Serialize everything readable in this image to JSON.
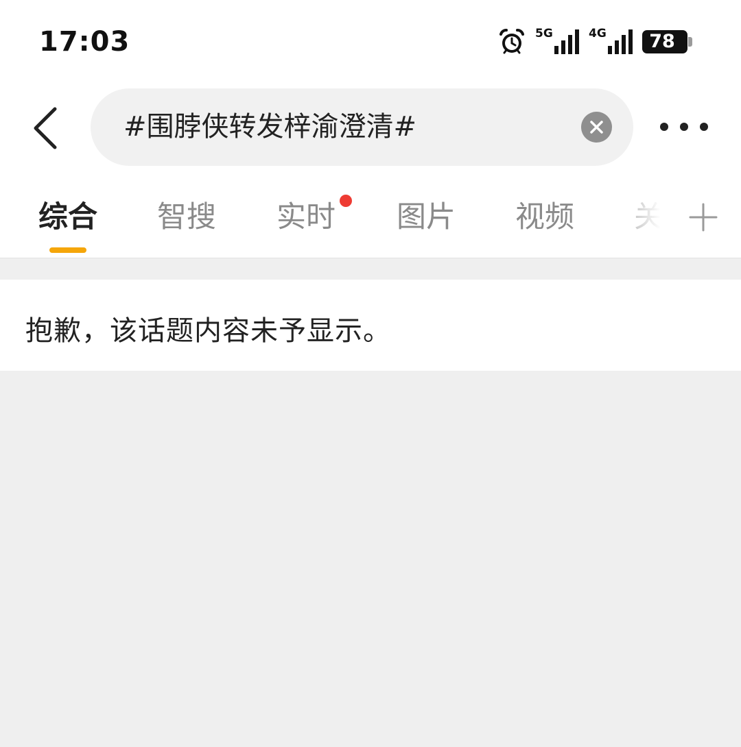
{
  "status_bar": {
    "time": "17:03",
    "alarm_icon": "alarm-clock-icon",
    "signal_1": {
      "network": "5G"
    },
    "signal_2": {
      "network": "4G"
    },
    "battery": "78"
  },
  "search": {
    "query": "#围脖侠转发梓渝澄清#",
    "back_icon": "chevron-left-icon",
    "clear_icon": "close-circle-icon",
    "more_icon": "more-horizontal-icon"
  },
  "tabs": [
    {
      "label": "综合",
      "active": true
    },
    {
      "label": "智搜"
    },
    {
      "label": "实时",
      "has_new_dot": true
    },
    {
      "label": "图片"
    },
    {
      "label": "视频"
    },
    {
      "label": "关"
    }
  ],
  "add_tab_icon": "plus-icon",
  "notice": {
    "message": "抱歉，该话题内容未予显示。"
  },
  "colors": {
    "accent": "#f5a60a",
    "dot": "#ee3b33",
    "background": "#efefef"
  }
}
